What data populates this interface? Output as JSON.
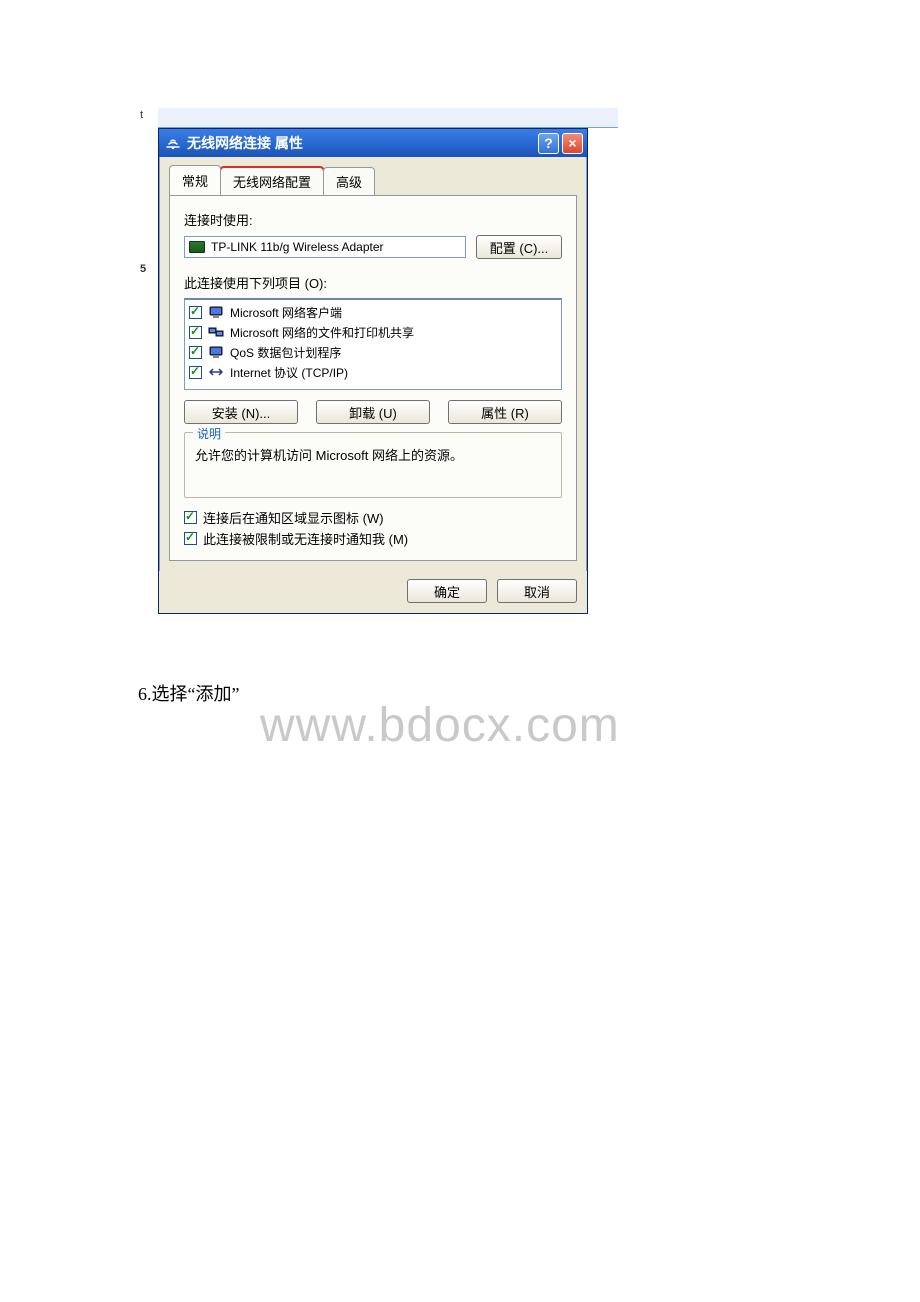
{
  "window": {
    "title": "无线网络连接  属性",
    "help_icon": "?",
    "close_icon": "×"
  },
  "tabs": {
    "general": "常规",
    "wireless": "无线网络配置",
    "advanced": "高级"
  },
  "labels": {
    "connect_using": "连接时使用:",
    "this_conn_uses": "此连接使用下列项目 (O):",
    "description_title": "说明"
  },
  "adapter": {
    "name": "TP-LINK 11b/g Wireless Adapter"
  },
  "buttons": {
    "configure": "配置 (C)...",
    "install": "安装 (N)...",
    "uninstall": "卸载 (U)",
    "properties": "属性 (R)",
    "ok": "确定",
    "cancel": "取消"
  },
  "items": [
    {
      "label": "Microsoft 网络客户端",
      "checked": true,
      "icon": "client"
    },
    {
      "label": "Microsoft 网络的文件和打印机共享",
      "checked": true,
      "icon": "share"
    },
    {
      "label": "QoS 数据包计划程序",
      "checked": true,
      "icon": "qos"
    },
    {
      "label": "Internet 协议 (TCP/IP)",
      "checked": true,
      "icon": "tcpip"
    }
  ],
  "description": "允许您的计算机访问 Microsoft 网络上的资源。",
  "bottom_checks": {
    "show_icon": "连接后在通知区域显示图标 (W)",
    "notify_limited": "此连接被限制或无连接时通知我 (M)"
  },
  "watermark": "www.bdocx.com",
  "caption": "6.选择“添加”",
  "left_bits": {
    "a": "t",
    "b": "5"
  }
}
